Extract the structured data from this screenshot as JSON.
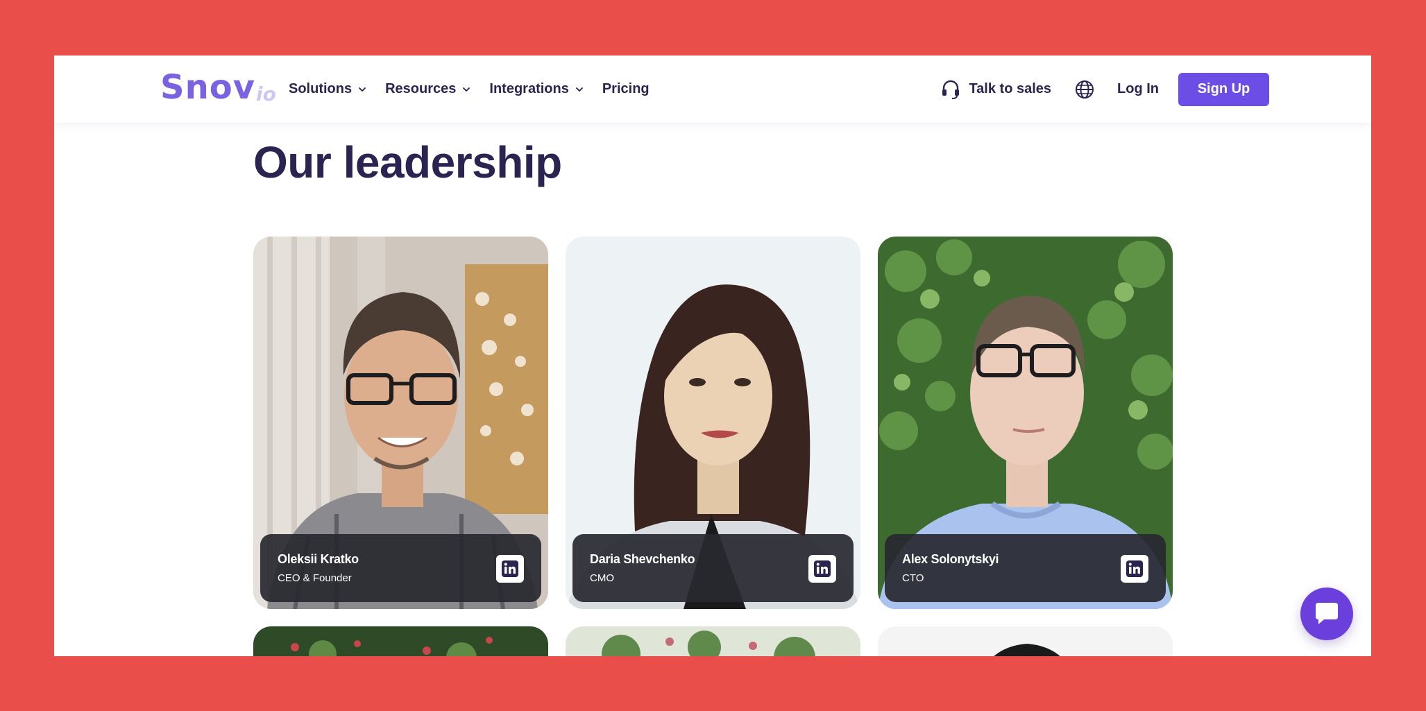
{
  "header": {
    "logo": {
      "main": "Snov",
      "sub": "io"
    },
    "nav": [
      {
        "label": "Solutions",
        "has_dropdown": true
      },
      {
        "label": "Resources",
        "has_dropdown": true
      },
      {
        "label": "Integrations",
        "has_dropdown": true
      },
      {
        "label": "Pricing",
        "has_dropdown": false
      }
    ],
    "talk_to_sales": "Talk to sales",
    "login": "Log In",
    "signup": "Sign Up"
  },
  "section": {
    "title": "Our leadership",
    "people": [
      {
        "name": "Oleksii Kratko",
        "role": "CEO & Founder",
        "icon": "linkedin-icon"
      },
      {
        "name": "Daria Shevchenko",
        "role": "CMO",
        "icon": "linkedin-icon"
      },
      {
        "name": "Alex Solonytskyi",
        "role": "CTO",
        "icon": "linkedin-icon"
      }
    ]
  },
  "colors": {
    "page_bg": "#e94e4b",
    "brand": "#6c4ee6",
    "heading": "#2b2451",
    "chat": "#6b3fdc"
  }
}
